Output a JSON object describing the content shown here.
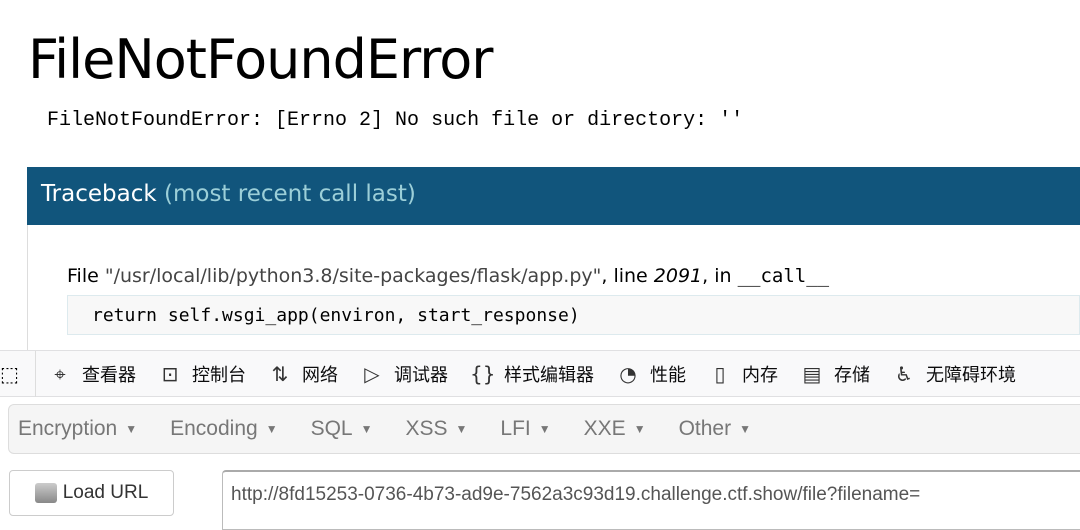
{
  "page": {
    "title": "FileNotFoundError",
    "error_message": "FileNotFoundError: [Errno 2] No such file or directory: ''"
  },
  "traceback": {
    "heading": "Traceback",
    "heading_sub": "(most recent call last)",
    "frames": [
      {
        "prefix": "File ",
        "path": "\"/usr/local/lib/python3.8/site-packages/flask/app.py\"",
        "line_label": ", line ",
        "line": "2091",
        "in_label": ", in ",
        "function": "__call__",
        "code": "return self.wsgi_app(environ, start_response)"
      }
    ]
  },
  "devtools": {
    "tabs": [
      {
        "label": "查看器",
        "icon": "inspector-icon",
        "glyph": "⌖"
      },
      {
        "label": "控制台",
        "icon": "console-icon",
        "glyph": "⊡"
      },
      {
        "label": "网络",
        "icon": "network-icon",
        "glyph": "⇅"
      },
      {
        "label": "调试器",
        "icon": "debugger-icon",
        "glyph": "▷"
      },
      {
        "label": "样式编辑器",
        "icon": "style-editor-icon",
        "glyph": "{}"
      },
      {
        "label": "性能",
        "icon": "performance-icon",
        "glyph": "◔"
      },
      {
        "label": "内存",
        "icon": "memory-icon",
        "glyph": "▯"
      },
      {
        "label": "存储",
        "icon": "storage-icon",
        "glyph": "▤"
      },
      {
        "label": "无障碍环境",
        "icon": "accessibility-icon",
        "glyph": "♿"
      }
    ]
  },
  "hackbar": {
    "menus": [
      "Encryption",
      "Encoding",
      "SQL",
      "XSS",
      "LFI",
      "XXE",
      "Other"
    ],
    "load_url": "Load URL",
    "url": "http://8fd15253-0736-4b73-ad9e-7562a3c93d19.challenge.ctf.show/file?filename="
  }
}
